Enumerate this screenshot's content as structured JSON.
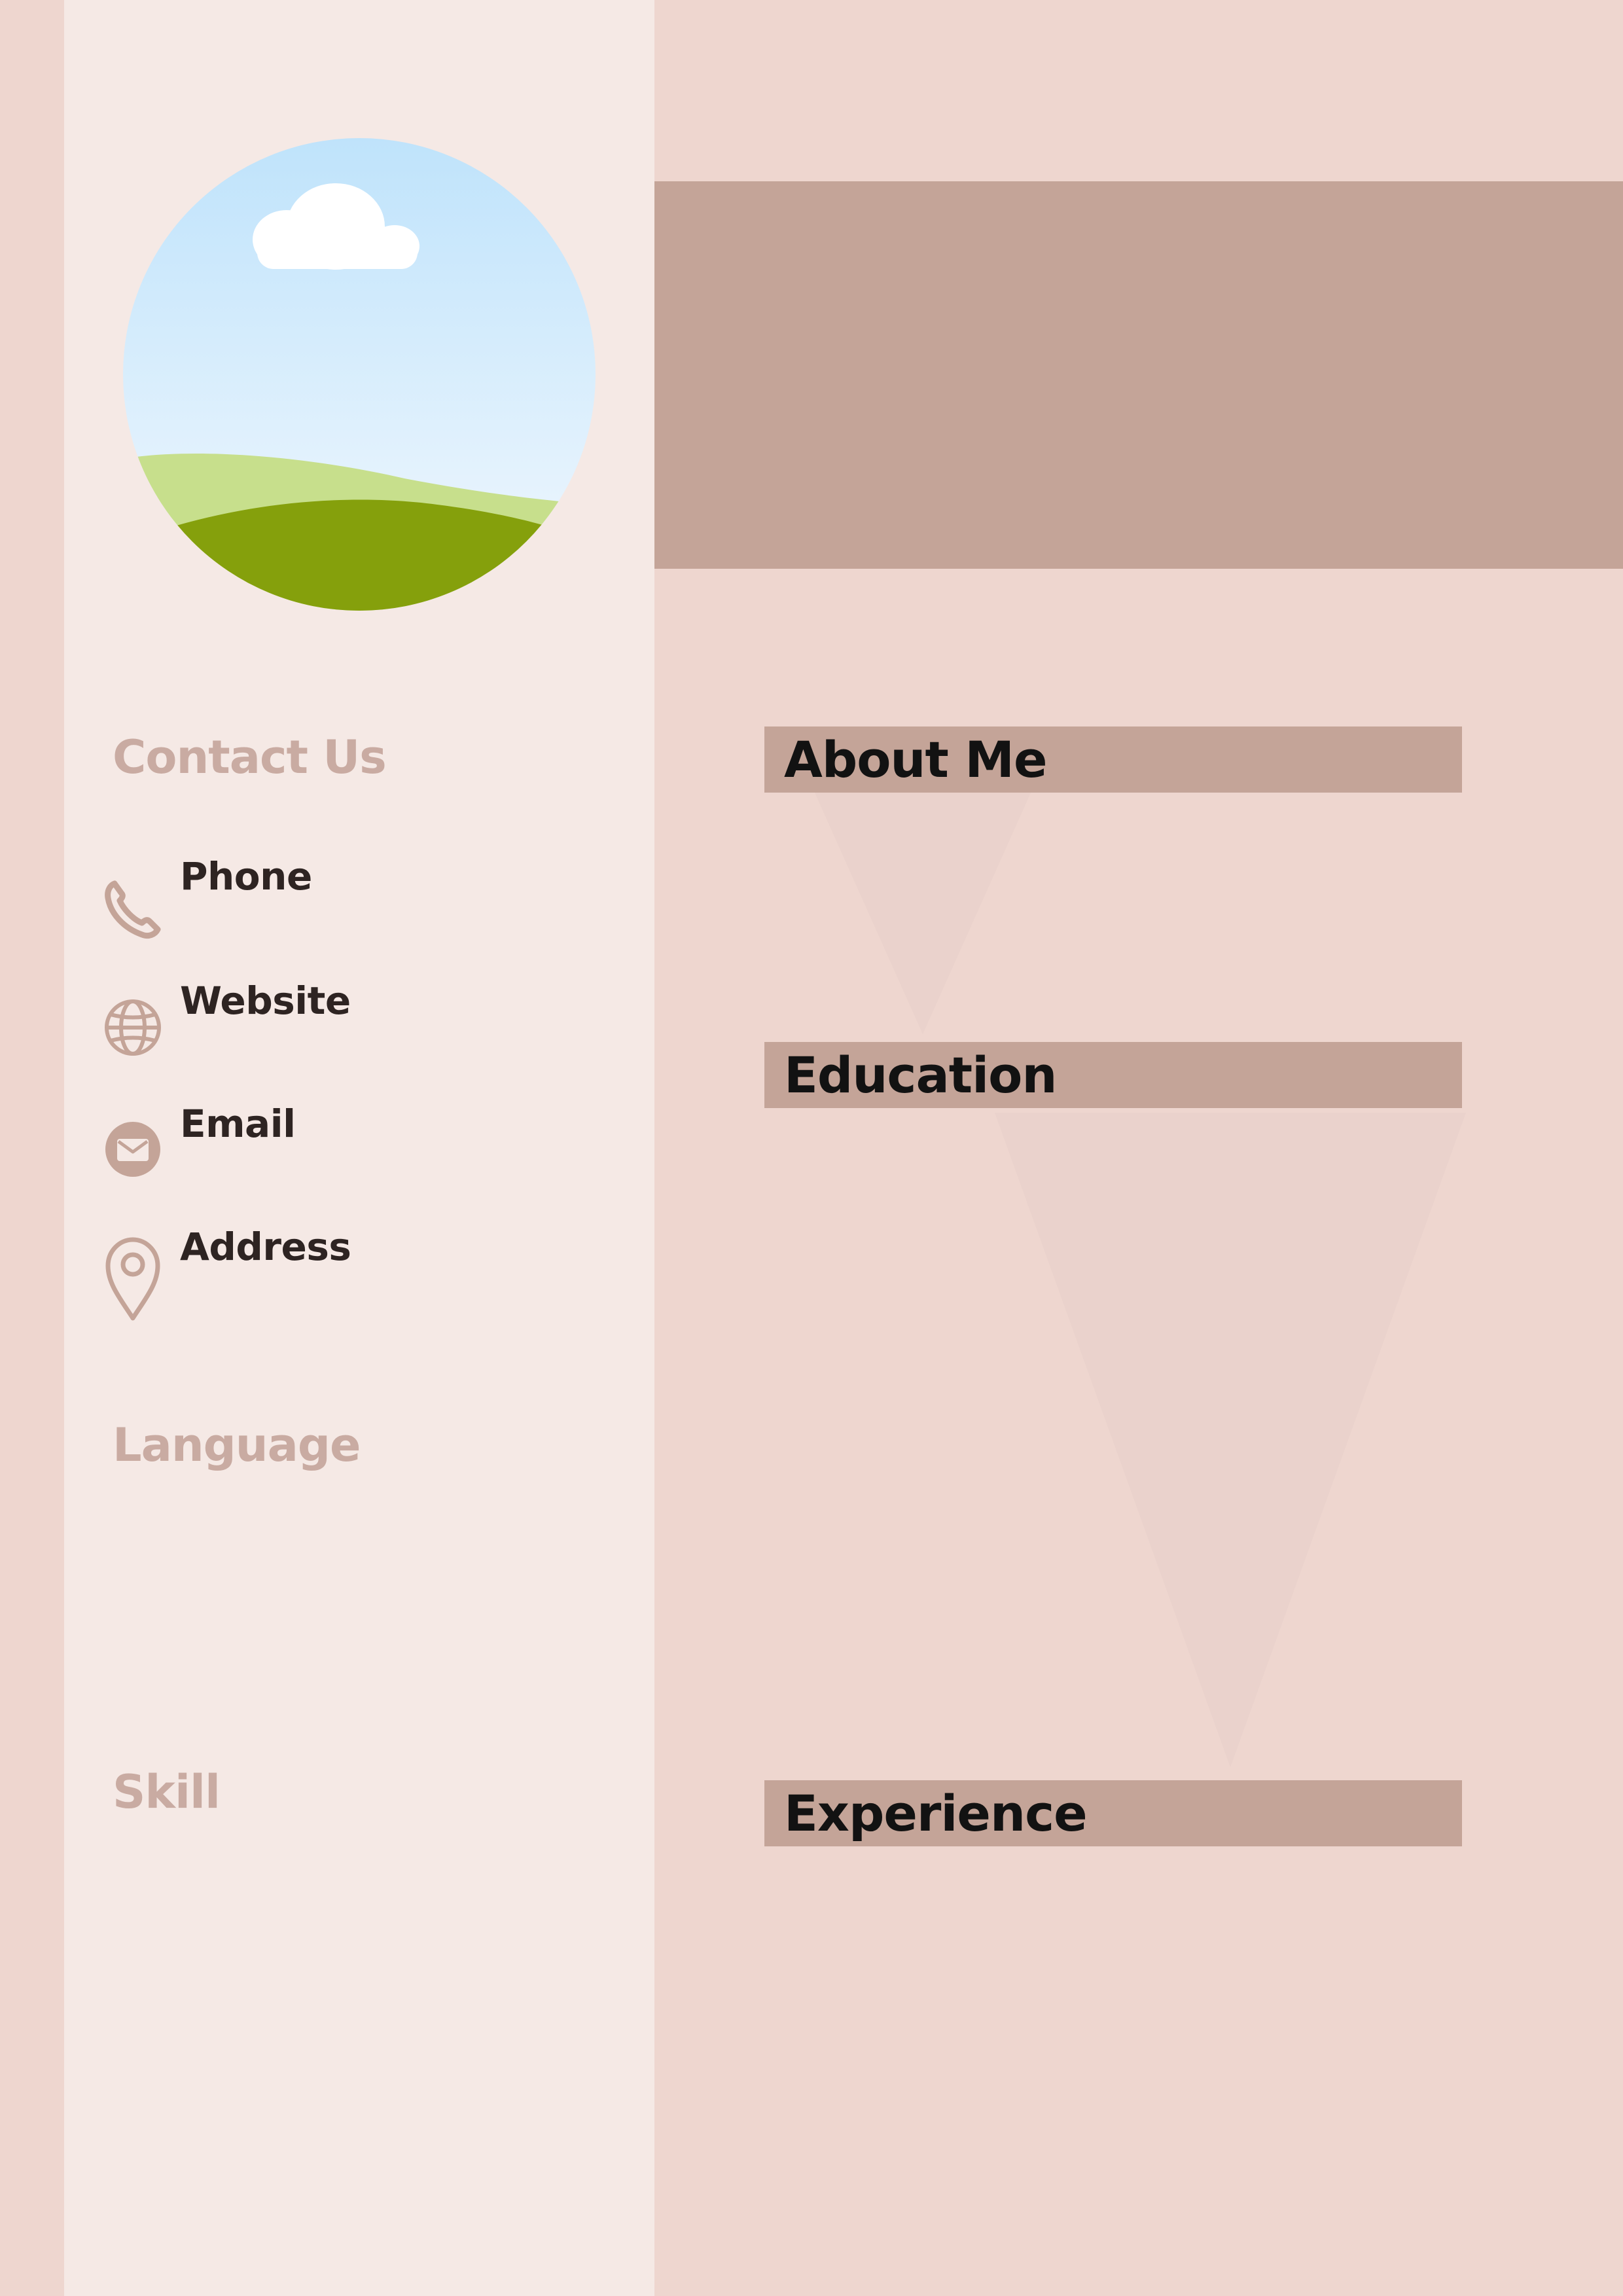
{
  "colors": {
    "page_background": "#EED6CF",
    "sidebar_background": "#F5E9E5",
    "accent_band": "#C4A498",
    "left_heading": "#C9ABA2",
    "contact_text": "#2E2422",
    "main_heading_text": "#121212",
    "icon": "#C4A498"
  },
  "photo": {
    "icon": "landscape-placeholder-icon"
  },
  "sidebar": {
    "contact_title": "Contact Us",
    "contact_items": [
      {
        "icon": "phone-icon",
        "label": "Phone"
      },
      {
        "icon": "globe-icon",
        "label": "Website"
      },
      {
        "icon": "mail-icon",
        "label": "Email"
      },
      {
        "icon": "location-pin-icon",
        "label": "Address"
      }
    ],
    "language_title": "Language",
    "skill_title": "Skill"
  },
  "main": {
    "sections": [
      {
        "title": "About Me"
      },
      {
        "title": "Education"
      },
      {
        "title": "Experience"
      }
    ]
  }
}
